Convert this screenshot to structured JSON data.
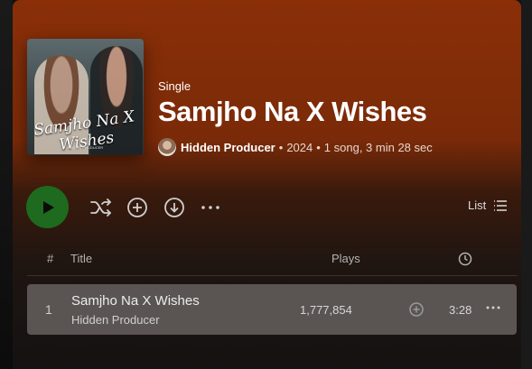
{
  "album": {
    "type": "Single",
    "title": "Samjho Na X Wishes",
    "cover_text": "Samjho Na X Wishes",
    "cover_small_text": "HIDDEN PRODUCER",
    "artist": "Hidden Producer",
    "year": "2024",
    "summary": "1 song, 3 min 28 sec",
    "separator": "•"
  },
  "controls": {
    "play_icon": "play-icon",
    "shuffle_icon": "shuffle-icon",
    "add_icon": "plus-circle-icon",
    "download_icon": "download-icon",
    "more_icon": "more-horizontal-icon",
    "view_label": "List",
    "view_icon": "list-icon"
  },
  "table": {
    "headers": {
      "number": "#",
      "title": "Title",
      "plays": "Plays",
      "duration_icon": "clock-icon"
    },
    "rows": [
      {
        "number": "1",
        "title": "Samjho Na X Wishes",
        "artist": "Hidden Producer",
        "plays": "1,777,854",
        "duration": "3:28"
      }
    ]
  },
  "colors": {
    "header_gradient_top": "#8a2f08",
    "play_button": "#1e6a1e",
    "row_hover": "#5a5553",
    "background": "#121212"
  }
}
